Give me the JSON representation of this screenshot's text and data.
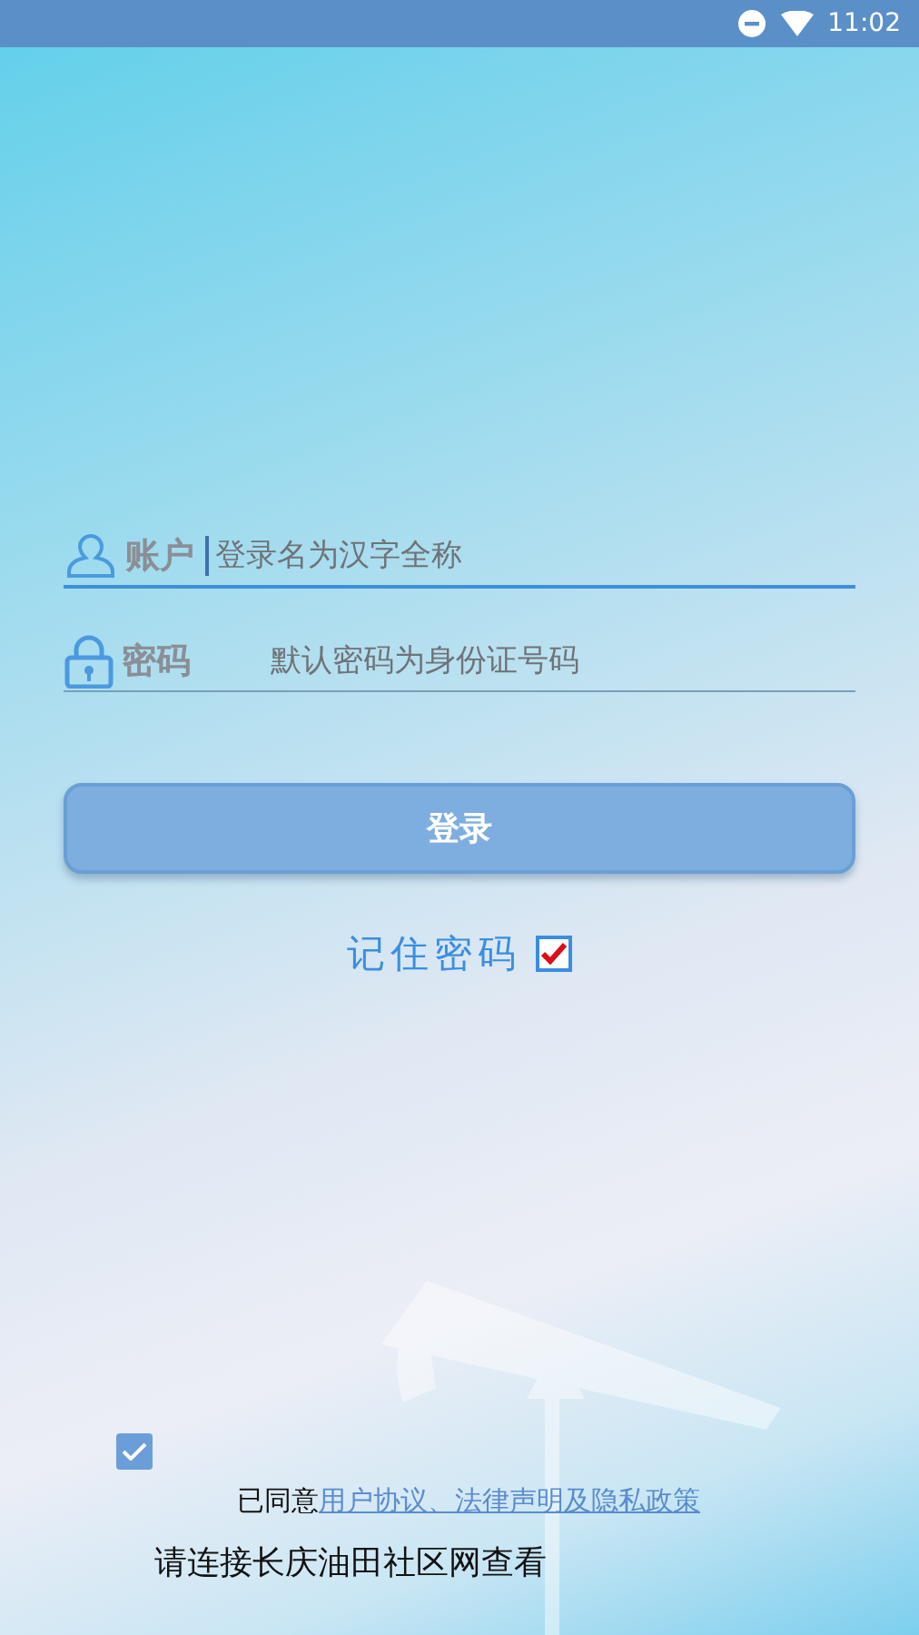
{
  "status_bar": {
    "time": "11:02"
  },
  "form": {
    "fields": [
      {
        "kind": "account",
        "label": "账户",
        "placeholder": "登录名为汉字全称",
        "focused": true
      },
      {
        "kind": "password",
        "label": "密码",
        "placeholder": "默认密码为身份证号码",
        "focused": false
      }
    ],
    "login_button": "登录",
    "remember": {
      "label": "记住密码",
      "checked": true
    }
  },
  "agreement": {
    "checked": true,
    "prefix": "已同意",
    "link": "用户协议、法律声明及隐私政策"
  },
  "notice": "请连接长庆油田社区网查看"
}
